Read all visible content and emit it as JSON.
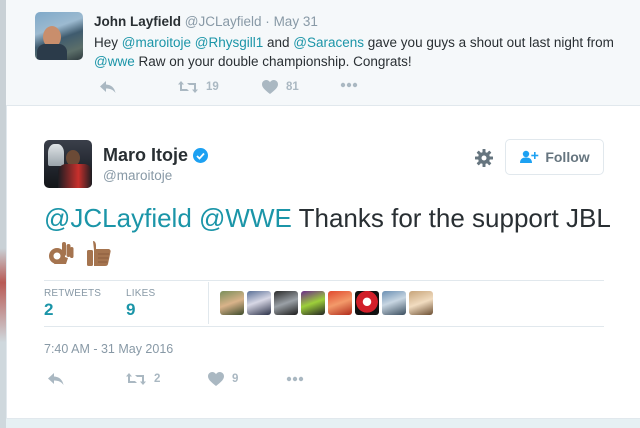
{
  "previous_tweet": {
    "name": "John Layfield",
    "handle": "@JCLayfield",
    "separator": "·",
    "date": "May 31",
    "text_parts": [
      {
        "text": "Hey ",
        "mention": false
      },
      {
        "text": "@maroitoje",
        "mention": true
      },
      {
        "text": " ",
        "mention": false
      },
      {
        "text": "@Rhysgill1",
        "mention": true
      },
      {
        "text": " and ",
        "mention": false
      },
      {
        "text": "@Saracens",
        "mention": true
      },
      {
        "text": " gave you guys a shout out last night from ",
        "mention": false
      },
      {
        "text": "@wwe",
        "mention": true
      },
      {
        "text": " Raw on your double championship. Congrats!",
        "mention": false
      }
    ],
    "retweet_count": "19",
    "like_count": "81"
  },
  "tweet": {
    "name": "Maro Itoje",
    "handle": "@maroitoje",
    "follow_label": "Follow",
    "mention_1": "@JCLayfield",
    "mention_2": "@WWE",
    "text": " Thanks for the support JBL",
    "emojis": [
      "ok-hand-emoji",
      "thumbs-up-emoji"
    ],
    "retweets_label": "RETWEETS",
    "retweets_value": "2",
    "likes_label": "LIKES",
    "likes_value": "9",
    "timestamp": "7:40 AM - 31 May 2016",
    "action_retweet_count": "2",
    "action_like_count": "9"
  },
  "likers": [
    "liker-1",
    "liker-2",
    "liker-3",
    "liker-4",
    "liker-5",
    "liker-6",
    "liker-7",
    "liker-8"
  ],
  "colors": {
    "mention": "#1b95a8",
    "verified": "#1da1f2",
    "muted": "#8899a6",
    "icon": "#aab8c2"
  },
  "icons": [
    "reply-icon",
    "retweet-icon",
    "heart-icon",
    "more-icon",
    "gear-icon",
    "follow-person-icon",
    "verified-badge-icon"
  ]
}
